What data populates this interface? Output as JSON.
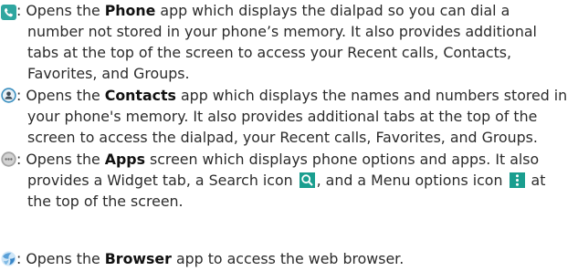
{
  "items": [
    {
      "icon": "phone-app-icon",
      "lines": [
        {
          "pre": ": Opens the ",
          "bold": "Phone",
          "post": " app which displays the dialpad so you can dial a"
        },
        {
          "text": "number not stored in your phone’s memory. It also provides additional"
        },
        {
          "text": "tabs at the top of the screen to access your Recent calls, Contacts,"
        },
        {
          "text": "Favorites, and Groups."
        }
      ]
    },
    {
      "icon": "contacts-app-icon",
      "lines": [
        {
          "pre": ": Opens the ",
          "bold": "Contacts",
          "post": " app which displays the names and numbers stored in"
        },
        {
          "text": "your phone's memory. It also provides additional tabs at the top of the"
        },
        {
          "text": "screen to access the dialpad, your Recent calls, Favorites, and Groups."
        }
      ]
    },
    {
      "icon": "apps-icon",
      "lines": [
        {
          "pre": ": Opens the ",
          "bold": "Apps",
          "post": " screen which displays phone options and apps. It also"
        },
        {
          "pre": "provides a Widget tab, a Search icon ",
          "mid": ", and a Menu options icon ",
          "post": " at"
        },
        {
          "text": "the top of the screen."
        }
      ]
    },
    {
      "icon": "browser-app-icon",
      "lines": [
        {
          "pre": ": Opens the ",
          "bold": "Browser",
          "post": " app to access the web browser."
        }
      ]
    }
  ],
  "colors": {
    "text": "#2b2b2b",
    "phone_icon": "#2fa6a0",
    "contacts_icon": "#3b8fbf",
    "apps_icon": "#9a9a9a",
    "inline_icon_bg": "#1a9e8f",
    "browser_icon": "#5aa0d8"
  }
}
